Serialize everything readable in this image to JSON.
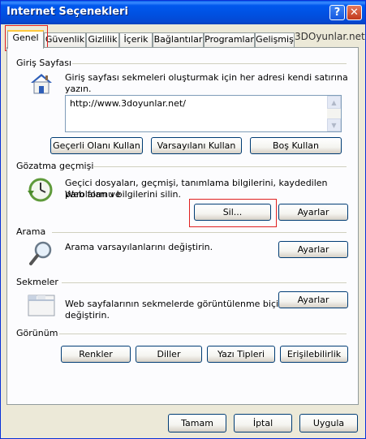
{
  "window": {
    "title": "Internet Seçenekleri",
    "help": "?",
    "close": "✕"
  },
  "watermark": "3DOyunlar.net",
  "tabs": [
    "Genel",
    "Güvenlik",
    "Gizlilik",
    "İçerik",
    "Bağlantılar",
    "Programlar",
    "Gelişmiş"
  ],
  "home": {
    "header": "Giriş Sayfası",
    "description": "Giriş sayfası sekmeleri oluşturmak için her adresi kendi satırına yazın.",
    "url": "http://www.3doyunlar.net/",
    "buttons": {
      "current": "Geçerli Olanı Kullan",
      "default": "Varsayılanı Kullan",
      "blank": "Boş Kullan"
    }
  },
  "history": {
    "header": "Gözatma geçmişi",
    "description_1": "Geçici dosyaları, geçmişi, tanımlama bilgilerini, kaydedilen parolaları ve",
    "description_2": "Web formu bilgilerini silin.",
    "delete": "Sil...",
    "settings": "Ayarlar"
  },
  "search": {
    "header": "Arama",
    "description": "Arama varsayılanlarını değiştirin.",
    "settings": "Ayarlar"
  },
  "tabsection": {
    "header": "Sekmeler",
    "description_1": "Web sayfalarının sekmelerde görüntülenme biçimini",
    "description_2": "değiştirin.",
    "settings": "Ayarlar"
  },
  "appearance": {
    "header": "Görünüm",
    "buttons": {
      "colors": "Renkler",
      "languages": "Diller",
      "fonts": "Yazı Tipleri",
      "accessibility": "Erişilebilirlik"
    }
  },
  "footer": {
    "ok": "Tamam",
    "cancel": "İptal",
    "apply": "Uygula"
  }
}
